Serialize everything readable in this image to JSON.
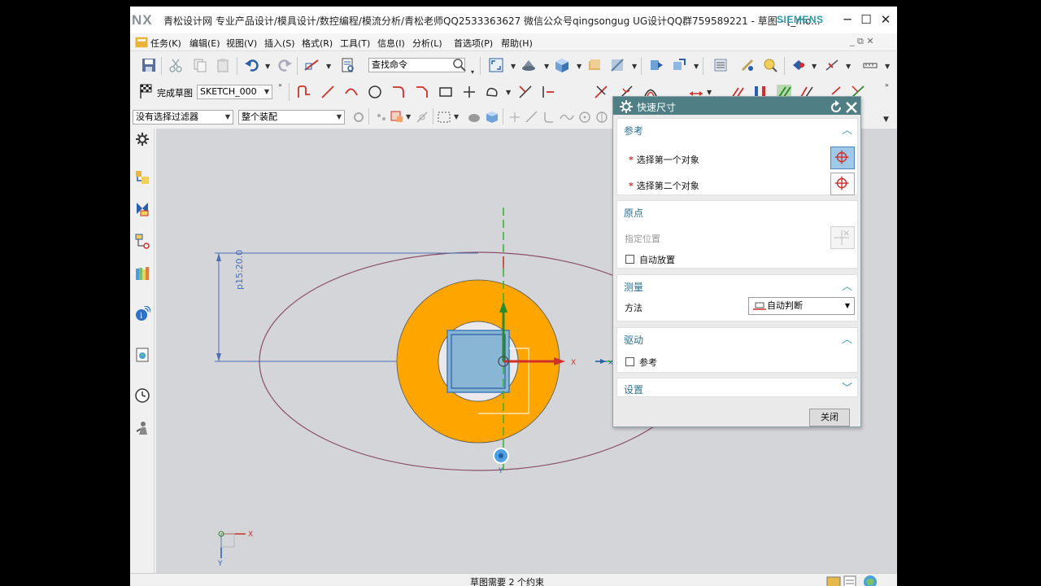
{
  "window": {
    "logo": "NX",
    "title": "青松设计网 专业产品设计/模具设计/数控编程/模流分析/青松老师QQ2533363627 微信公众号qingsongug UG设计QQ群759589221 - 草图 - [_mo...",
    "brand": "SIEMENS",
    "minimize": "─",
    "maximize": "☐",
    "close": "✕"
  },
  "menu": {
    "items": [
      "任务(K)",
      "编辑(E)",
      "视图(V)",
      "插入(S)",
      "格式(R)",
      "工具(T)",
      "信息(I)",
      "分析(L)",
      "首选项(P)",
      "帮助(H)"
    ],
    "doc_controls": "_ ⧉ ✕"
  },
  "toolbar": {
    "command_search_placeholder": "查找命令",
    "finish_sketch": "完成草图",
    "sketch_name": "SKETCH_000",
    "selection_filter": "没有选择过滤器",
    "assembly_scope": "整个装配"
  },
  "canvas": {
    "dimension_label": "p15:20.0",
    "axis_x": "X",
    "axis_y": "Y",
    "triad_x": "X",
    "triad_y": "Y"
  },
  "status": {
    "message": "草图需要 2 个约束"
  },
  "dialog": {
    "title": "快速尺寸",
    "sections": {
      "reference": {
        "title": "参考",
        "first_object": "选择第一个对象",
        "second_object": "选择第二个对象"
      },
      "origin": {
        "title": "原点",
        "specify_location": "指定位置",
        "auto_place": "自动放置"
      },
      "measure": {
        "title": "测量",
        "method_label": "方法",
        "method_value": "自动判断"
      },
      "drive": {
        "title": "驱动",
        "reference_checkbox": "参考"
      },
      "settings": {
        "title": "设置"
      }
    },
    "close_button": "关闭"
  },
  "colors": {
    "titlebar_accent": "#2d9aa6",
    "dialog_header": "#4f7e85",
    "ring_fill": "#ffa500",
    "canvas_bg": "#d4d5d9"
  }
}
